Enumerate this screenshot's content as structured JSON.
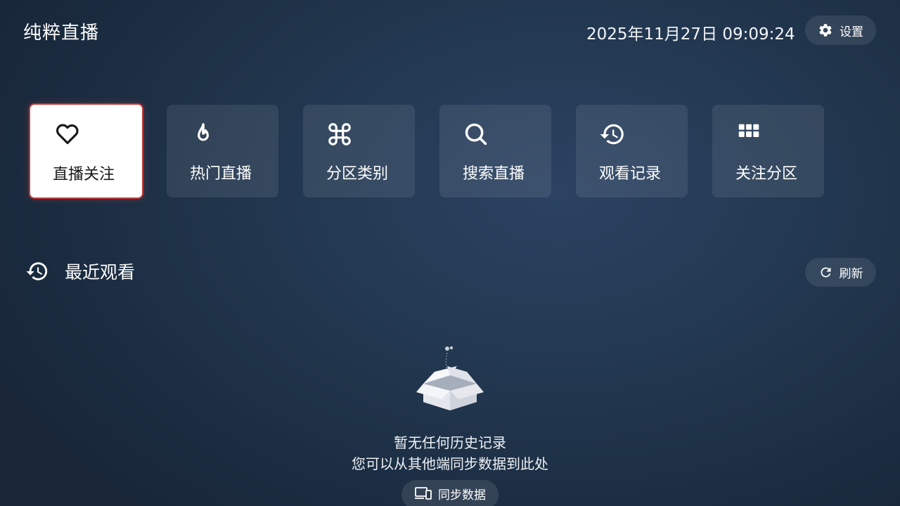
{
  "header": {
    "app_title": "纯粹直播",
    "datetime": "2025年11月27日 09:09:24",
    "settings_label": "设置",
    "settings_icon": "gear-icon"
  },
  "menu": {
    "items": [
      {
        "label": "直播关注",
        "icon": "heart-icon",
        "active": true
      },
      {
        "label": "热门直播",
        "icon": "flame-icon",
        "active": false
      },
      {
        "label": "分区类别",
        "icon": "command-icon",
        "active": false
      },
      {
        "label": "搜索直播",
        "icon": "search-icon",
        "active": false
      },
      {
        "label": "观看记录",
        "icon": "history-icon",
        "active": false
      },
      {
        "label": "关注分区",
        "icon": "grid-icon",
        "active": false
      }
    ]
  },
  "recent": {
    "title": "最近观看",
    "title_icon": "history-icon",
    "refresh_label": "刷新",
    "refresh_icon": "refresh-icon"
  },
  "empty_state": {
    "icon": "empty-box-icon",
    "line1": "暂无任何历史记录",
    "line2": "您可以从其他端同步数据到此处",
    "sync_label": "同步数据",
    "sync_icon": "devices-icon"
  },
  "colors": {
    "background": "#22374f",
    "active_card": "#ffffff",
    "active_border": "#c53a3a",
    "text": "#ffffff"
  }
}
